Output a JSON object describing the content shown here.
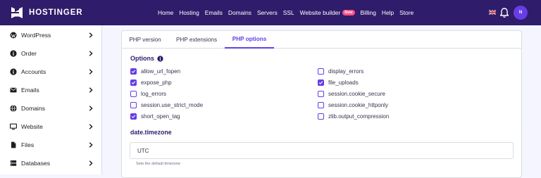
{
  "brand": {
    "name": "HOSTINGER"
  },
  "nav": {
    "items": [
      "Home",
      "Hosting",
      "Emails",
      "Domains",
      "Servers",
      "SSL",
      "Website builder",
      "Billing",
      "Help",
      "Store"
    ],
    "badge": "New",
    "avatar_initial": "N"
  },
  "sidebar": {
    "items": [
      {
        "label": "WordPress",
        "icon": "wordpress-icon"
      },
      {
        "label": "Order",
        "icon": "info-circle-icon"
      },
      {
        "label": "Accounts",
        "icon": "info-circle-icon"
      },
      {
        "label": "Emails",
        "icon": "mail-icon"
      },
      {
        "label": "Domains",
        "icon": "globe-icon"
      },
      {
        "label": "Website",
        "icon": "monitor-icon"
      },
      {
        "label": "Files",
        "icon": "file-icon"
      },
      {
        "label": "Databases",
        "icon": "database-icon"
      }
    ]
  },
  "tabs": [
    "PHP version",
    "PHP extensions",
    "PHP options"
  ],
  "active_tab": "PHP options",
  "options": {
    "title": "Options",
    "left": [
      {
        "label": "allow_url_fopen",
        "checked": true
      },
      {
        "label": "expose_php",
        "checked": true
      },
      {
        "label": "log_errors",
        "checked": false
      },
      {
        "label": "session.use_strict_mode",
        "checked": false
      },
      {
        "label": "short_open_tag",
        "checked": true
      }
    ],
    "right": [
      {
        "label": "display_errors",
        "checked": false
      },
      {
        "label": "file_uploads",
        "checked": true
      },
      {
        "label": "session.cookie_secure",
        "checked": false
      },
      {
        "label": "session.cookie_httponly",
        "checked": false
      },
      {
        "label": "zlib.output_compression",
        "checked": false
      }
    ]
  },
  "timezone": {
    "label": "date.timezone",
    "value": "UTC",
    "help": "Sets the default timezone"
  },
  "colors": {
    "brand": "#2f1c6a",
    "accent": "#673de6",
    "badge": "#fc5185"
  }
}
